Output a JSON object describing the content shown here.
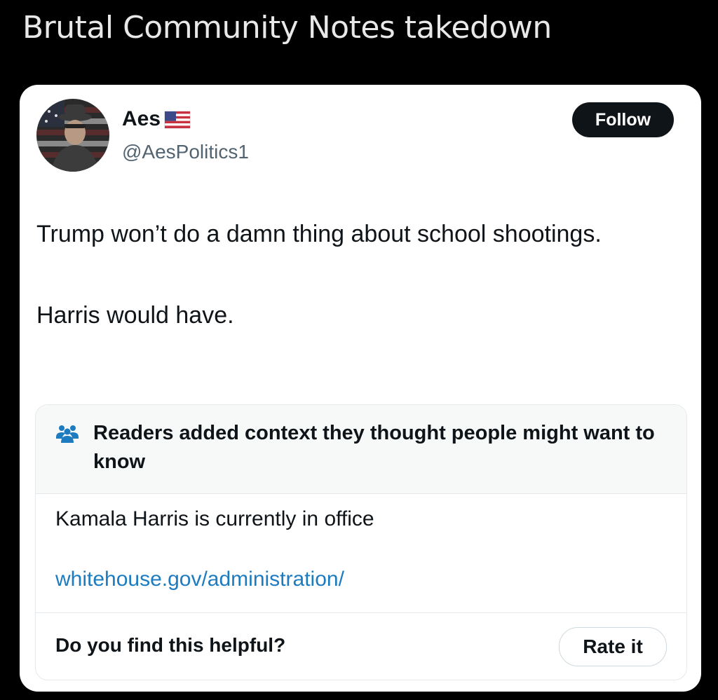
{
  "headline": "Brutal Community Notes takedown",
  "tweet": {
    "author_name": "Aes",
    "author_handle": "@AesPolitics1",
    "follow_label": "Follow",
    "text_lines": [
      "Trump won’t do a damn thing about school shootings.",
      "Harris would have."
    ]
  },
  "community_note": {
    "title": "Readers added context they thought people might want to know",
    "body": "Kamala Harris is currently in office",
    "link": "whitehouse.gov/administration/",
    "footer_question": "Do you find this helpful?",
    "rate_label": "Rate it"
  },
  "icons": {
    "author_badge": "us-flag-icon",
    "note_header": "people-icon"
  },
  "colors": {
    "background": "#000000",
    "card": "#ffffff",
    "link": "#1d7bbf",
    "follow_button": "#0f1419",
    "secondary_text": "#536471"
  }
}
